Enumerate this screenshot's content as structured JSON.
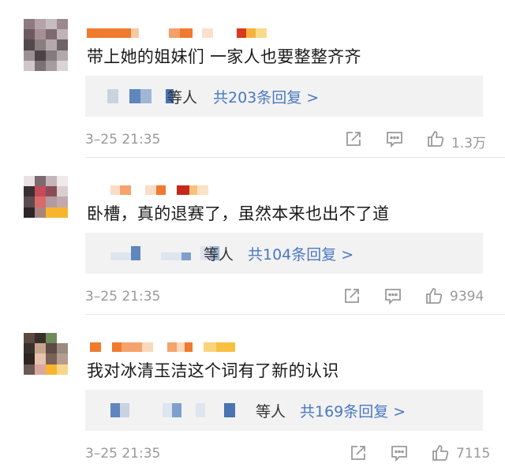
{
  "comments": [
    {
      "text": "带上她的姐妹们 一家人也要整整齐齐",
      "replies_others": "等人",
      "replies_count": "共203条回复 >",
      "timestamp": "3–25 21:35",
      "likes": "1.3万"
    },
    {
      "text": "卧槽，真的退赛了，虽然本来也出不了道",
      "replies_others": "等人",
      "replies_count": "共104条回复 >",
      "timestamp": "3–25 21:35",
      "likes": "9394"
    },
    {
      "text": "我对冰清玉洁这个词有了新的认识",
      "replies_others": "等人",
      "replies_count": "共169条回复 >",
      "timestamp": "3–25 21:35",
      "likes": "7115"
    }
  ],
  "icons": {
    "share": "share-icon",
    "comment": "comment-icon",
    "like": "thumbs-up-icon"
  },
  "colors": {
    "reply_link": "#4a78c2",
    "meta_text": "#999999",
    "reply_box": "#f2f2f2"
  }
}
